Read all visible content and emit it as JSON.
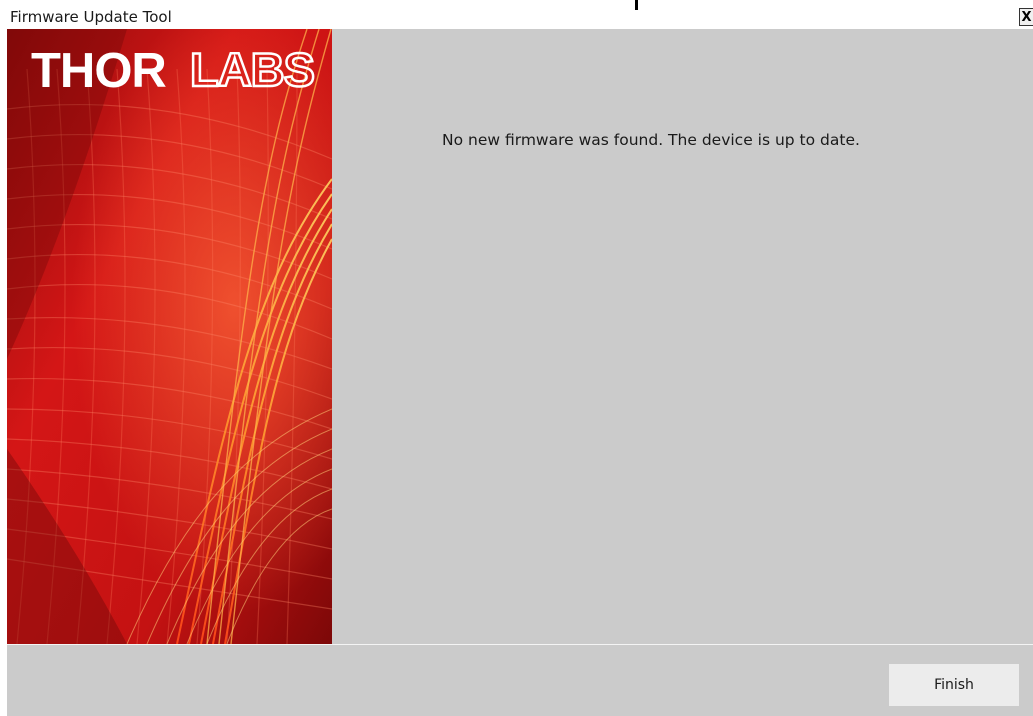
{
  "window": {
    "title": "Firmware Update Tool",
    "close_label": "X"
  },
  "banner": {
    "logo_bold": "THOR",
    "logo_outline": "LABS",
    "brand_color": "#c51313",
    "accent_color": "#f5a623"
  },
  "main": {
    "message": "No new firmware was found. The device is up to date."
  },
  "footer": {
    "finish_label": "Finish"
  }
}
